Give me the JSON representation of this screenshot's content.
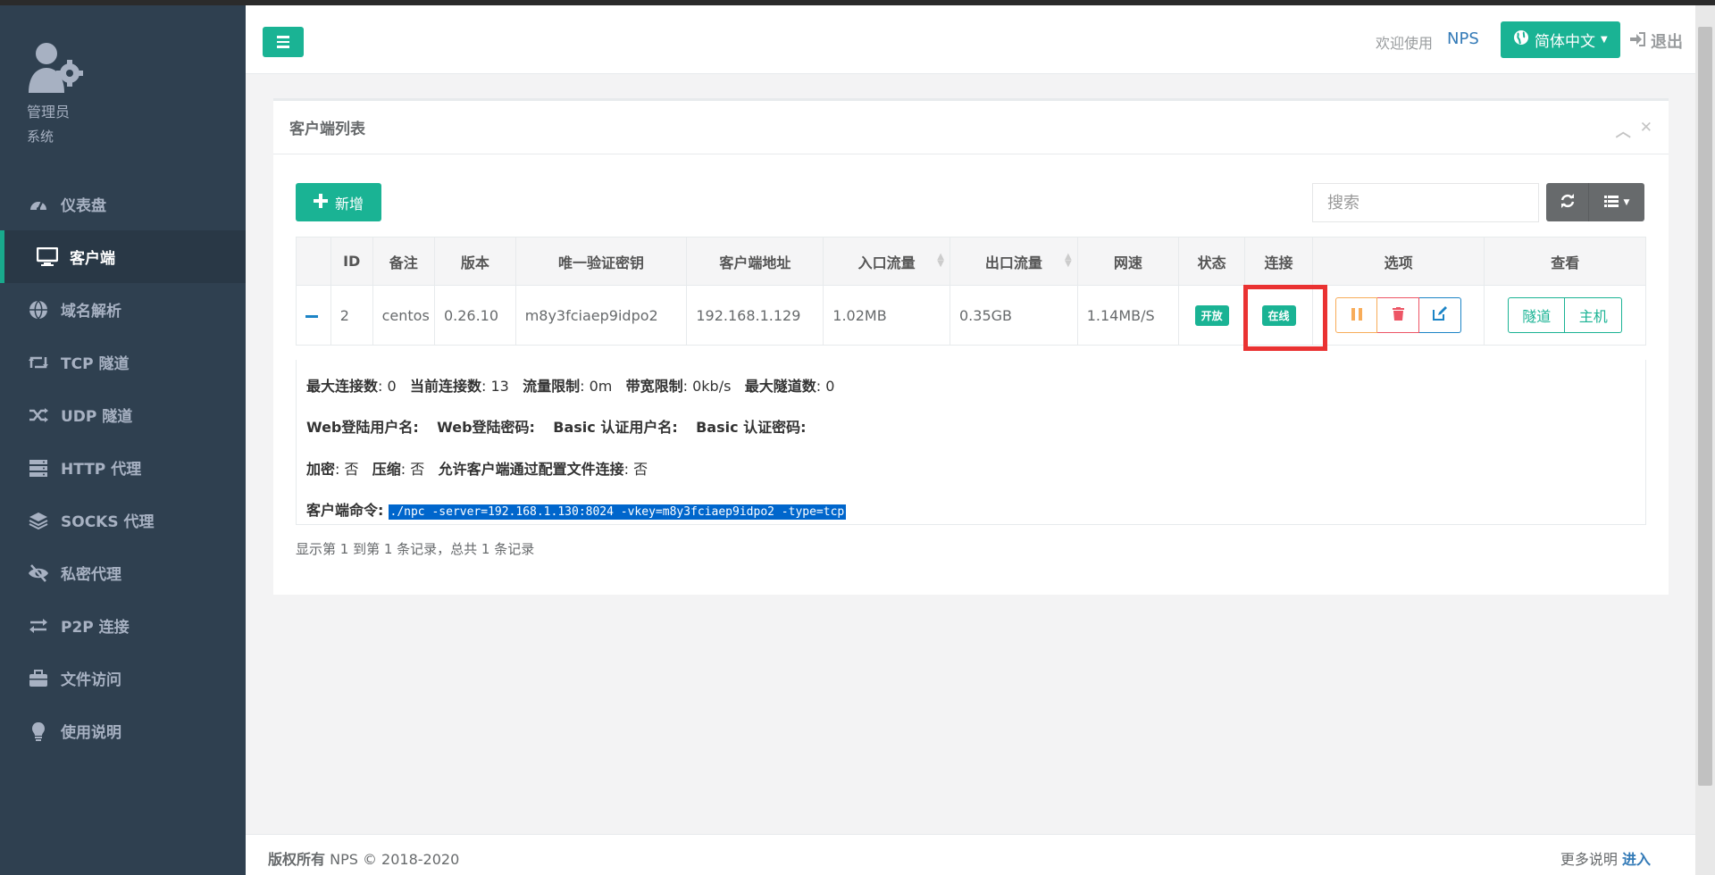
{
  "sidebar": {
    "profile": {
      "name": "管理员",
      "role": "系统"
    },
    "items": [
      {
        "label": "仪表盘",
        "icon": "dashboard-icon"
      },
      {
        "label": "客户端",
        "icon": "desktop-icon",
        "active": true
      },
      {
        "label": "域名解析",
        "icon": "globe-icon"
      },
      {
        "label": "TCP 隧道",
        "icon": "retweet-icon"
      },
      {
        "label": "UDP 隧道",
        "icon": "random-icon"
      },
      {
        "label": "HTTP 代理",
        "icon": "server-icon"
      },
      {
        "label": "SOCKS 代理",
        "icon": "layers-icon"
      },
      {
        "label": "私密代理",
        "icon": "eye-slash-icon"
      },
      {
        "label": "P2P 连接",
        "icon": "exchange-icon"
      },
      {
        "label": "文件访问",
        "icon": "briefcase-icon"
      },
      {
        "label": "使用说明",
        "icon": "lightbulb-icon"
      }
    ]
  },
  "topbar": {
    "welcome": "欢迎使用",
    "brand": "NPS",
    "language": "简体中文",
    "logout": "退出"
  },
  "panel": {
    "title": "客户端列表",
    "add_label": "新增",
    "search_placeholder": "搜索",
    "columns": [
      "ID",
      "备注",
      "版本",
      "唯一验证密钥",
      "客户端地址",
      "入口流量",
      "出口流量",
      "网速",
      "状态",
      "连接",
      "选项",
      "查看"
    ],
    "row": {
      "id": "2",
      "remark": "centos",
      "version": "0.26.10",
      "vkey": "m8y3fciaep9idpo2",
      "address": "192.168.1.129",
      "in_flow": "1.02MB",
      "out_flow": "0.35GB",
      "rate": "1.14MB/S",
      "status": "开放",
      "connection": "在线",
      "view_tunnel": "隧道",
      "view_host": "主机"
    },
    "detail": {
      "max_conn_label": "最大连接数",
      "max_conn": "0",
      "cur_conn_label": "当前连接数",
      "cur_conn": "13",
      "flow_limit_label": "流量限制",
      "flow_limit": "0m",
      "rate_limit_label": "带宽限制",
      "rate_limit": "0kb/s",
      "max_tunnel_label": "最大隧道数",
      "max_tunnel": "0",
      "web_user_label": "Web登陆用户名:",
      "web_pass_label": "Web登陆密码:",
      "basic_user_label": "Basic 认证用户名:",
      "basic_pass_label": "Basic 认证密码:",
      "crypt_label": "加密",
      "crypt": "否",
      "compress_label": "压缩",
      "compress": "否",
      "config_conn_label": "允许客户端通过配置文件连接",
      "config_conn": "否",
      "command_label": "客户端命令:",
      "command": "./npc -server=192.168.1.130:8024 -vkey=m8y3fciaep9idpo2 -type=tcp"
    },
    "pager": "显示第 1 到第 1 条记录，总共 1 条记录"
  },
  "footer": {
    "copyright_label": "版权所有",
    "copyright_text": "NPS © 2018-2020",
    "more_label": "更多说明",
    "more_link": "进入"
  },
  "colors": {
    "accent": "#1ab394",
    "sidebar": "#2f4050",
    "danger": "#ed5565",
    "warning": "#f8ac59",
    "info": "#1c84c6"
  }
}
